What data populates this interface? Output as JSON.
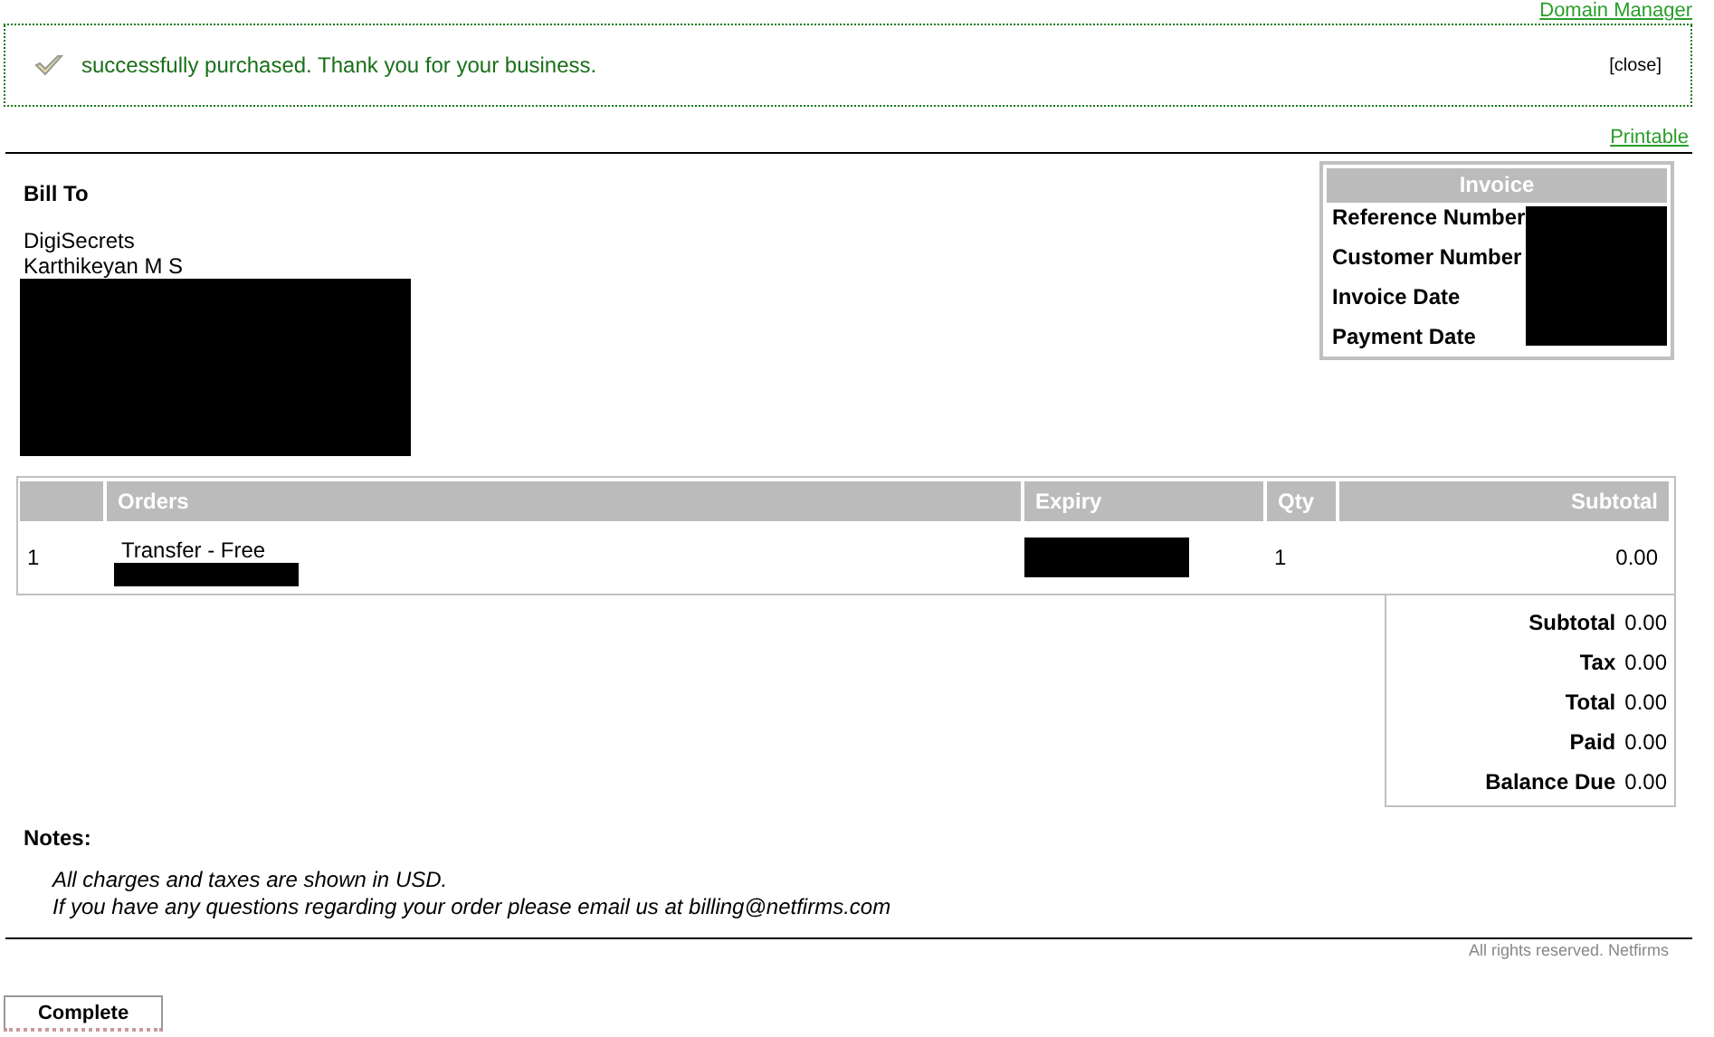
{
  "top_link": "Domain Manager",
  "notice": {
    "message": "successfully purchased. Thank you for your business.",
    "close": "[close]"
  },
  "printable": "Printable",
  "bill_to": {
    "title": "Bill To",
    "lines": [
      "DigiSecrets",
      "Karthikeyan M S"
    ],
    "redacted": true
  },
  "invoice": {
    "title": "Invoice",
    "fields": [
      "Reference Number",
      "Customer Number",
      "Invoice Date",
      "Payment Date"
    ],
    "values_redacted": true
  },
  "orders": {
    "columns": [
      "",
      "Orders",
      "Expiry",
      "Qty",
      "Subtotal"
    ],
    "rows": [
      {
        "number": "1",
        "item": "Transfer - Free",
        "detail_redacted": true,
        "expiry_redacted": true,
        "qty": "1",
        "subtotal": "0.00"
      }
    ]
  },
  "totals": [
    {
      "label": "Subtotal",
      "value": "0.00"
    },
    {
      "label": "Tax",
      "value": "0.00"
    },
    {
      "label": "Total",
      "value": "0.00"
    },
    {
      "label": "Paid",
      "value": "0.00"
    },
    {
      "label": "Balance Due",
      "value": "0.00"
    }
  ],
  "notes": {
    "title": "Notes:",
    "lines": [
      "All charges and taxes are shown in USD.",
      "If you have any questions regarding your order please email us at billing@netfirms.com"
    ]
  },
  "footer": "All rights reserved. Netfirms",
  "button": "Complete"
}
